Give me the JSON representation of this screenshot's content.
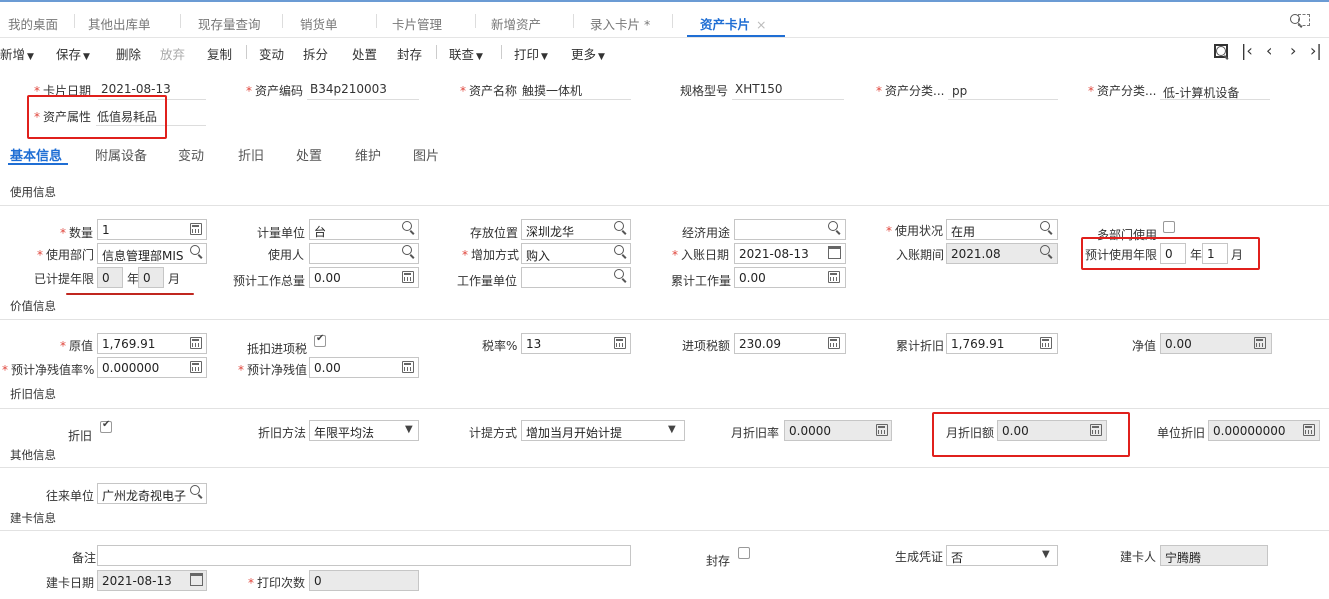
{
  "tabs": [
    "我的桌面",
    "其他出库单",
    "现存量查询",
    "销货单",
    "卡片管理",
    "新增资产",
    "录入卡片 *",
    "资产卡片"
  ],
  "tab_close": "×",
  "toolbar": {
    "add": "新增",
    "save": "保存",
    "delete": "删除",
    "discard": "放弃",
    "copy": "复制",
    "change": "变动",
    "split": "拆分",
    "dispose": "处置",
    "seal": "封存",
    "linked": "联查",
    "print": "打印",
    "more": "更多"
  },
  "header": {
    "card_date_label": "卡片日期",
    "card_date": "2021-08-13",
    "asset_code_label": "资产编码",
    "asset_code": "B34p210003",
    "asset_name_label": "资产名称",
    "asset_name": "触摸一体机",
    "spec_label": "规格型号",
    "spec": "XHT150",
    "category1_label": "资产分类...",
    "category1": "pp",
    "category2_label": "资产分类...",
    "category2": "低-计算机设备",
    "property_label": "资产属性",
    "property": "低值易耗品"
  },
  "subtabs": [
    "基本信息",
    "附属设备",
    "变动",
    "折旧",
    "处置",
    "维护",
    "图片"
  ],
  "usage": {
    "section": "使用信息",
    "qty_label": "数量",
    "qty": "1",
    "unit_label": "计量单位",
    "unit": "台",
    "location_label": "存放位置",
    "location": "深圳龙华",
    "purpose_label": "经济用途",
    "purpose": "",
    "status_label": "使用状况",
    "status": "在用",
    "multidept_label": "多部门使用",
    "dept_label": "使用部门",
    "dept": "信息管理部MIS",
    "user_label": "使用人",
    "user": "",
    "addway_label": "增加方式",
    "addway": "购入",
    "entry_date_label": "入账日期",
    "entry_date": "2021-08-13",
    "entry_period_label": "入账期间",
    "entry_period": "2021.08",
    "est_life_label": "预计使用年限",
    "est_life_years": "0",
    "est_life_months": "1",
    "year_unit": "年",
    "month_unit": "月",
    "accrued_label": "已计提年限",
    "accrued_years": "0",
    "accrued_months": "0",
    "est_workload_label": "预计工作总量",
    "est_workload": "0.00",
    "workload_unit_label": "工作量单位",
    "workload_unit": "",
    "cum_workload_label": "累计工作量",
    "cum_workload": "0.00"
  },
  "value": {
    "section": "价值信息",
    "orig_label": "原值",
    "orig": "1,769.91",
    "deduct_label": "抵扣进项税",
    "tax_rate_label": "税率%",
    "tax_rate": "13",
    "input_tax_label": "进项税额",
    "input_tax": "230.09",
    "cum_dep_label": "累计折旧",
    "cum_dep": "1,769.91",
    "net_label": "净值",
    "net": "0.00",
    "salvage_rate_label": "预计净残值率%",
    "salvage_rate": "0.000000",
    "salvage_label": "预计净残值",
    "salvage": "0.00"
  },
  "depreciation": {
    "section": "折旧信息",
    "dep_label": "折旧",
    "method_label": "折旧方法",
    "method": "年限平均法",
    "accrual_label": "计提方式",
    "accrual": "增加当月开始计提",
    "monthly_rate_label": "月折旧率",
    "monthly_rate": "0.0000",
    "monthly_amount_label": "月折旧额",
    "monthly_amount": "0.00",
    "unit_dep_label": "单位折旧",
    "unit_dep": "0.00000000"
  },
  "other": {
    "section": "其他信息",
    "partner_label": "往来单位",
    "partner": "广州龙奇视电子"
  },
  "build": {
    "section": "建卡信息",
    "remark_label": "备注",
    "remark": "",
    "seal_label": "封存",
    "voucher_label": "生成凭证",
    "voucher": "否",
    "builder_label": "建卡人",
    "builder": "宁腾腾",
    "build_date_label": "建卡日期",
    "build_date": "2021-08-13",
    "print_count_label": "打印次数",
    "print_count": "0"
  }
}
